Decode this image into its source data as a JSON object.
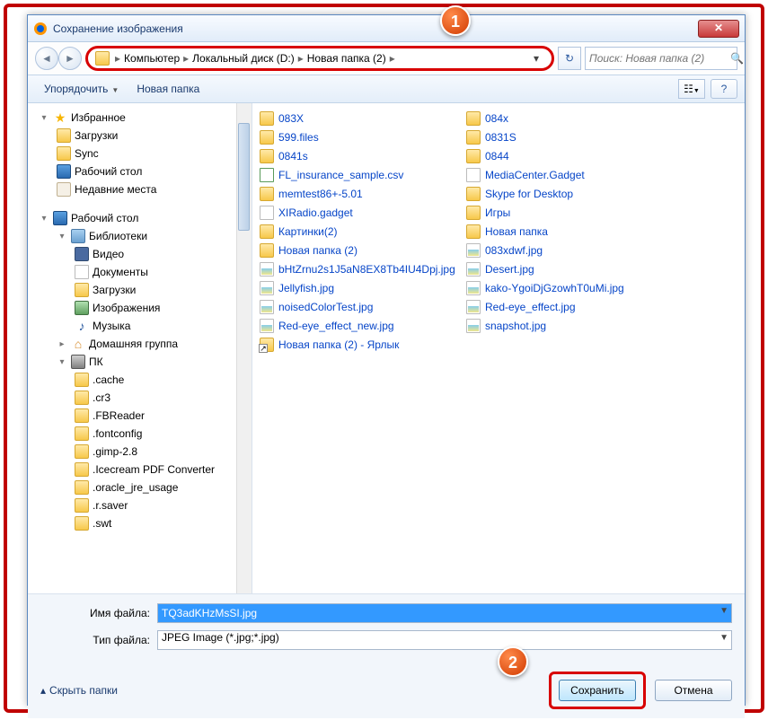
{
  "title": "Сохранение изображения",
  "breadcrumb": [
    "Компьютер",
    "Локальный диск (D:)",
    "Новая папка (2)"
  ],
  "search": {
    "placeholder": "Поиск: Новая папка (2)"
  },
  "toolbar": {
    "organize": "Упорядочить",
    "newfolder": "Новая папка"
  },
  "sidebar": {
    "favorites": {
      "label": "Избранное",
      "items": [
        "Загрузки",
        "Sync",
        "Рабочий стол",
        "Недавние места"
      ]
    },
    "desktop": {
      "label": "Рабочий стол"
    },
    "libraries": {
      "label": "Библиотеки",
      "items": [
        "Видео",
        "Документы",
        "Загрузки",
        "Изображения",
        "Музыка"
      ]
    },
    "homegroup": {
      "label": "Домашняя группа"
    },
    "pc": {
      "label": "ПК",
      "items": [
        ".cache",
        ".cr3",
        ".FBReader",
        ".fontconfig",
        ".gimp-2.8",
        ".Icecream PDF Converter",
        ".oracle_jre_usage",
        ".r.saver",
        ".swt"
      ]
    }
  },
  "files": {
    "col1": [
      {
        "n": "083X",
        "t": "folder"
      },
      {
        "n": "599.files",
        "t": "folder"
      },
      {
        "n": "0841s",
        "t": "folder"
      },
      {
        "n": "FL_insurance_sample.csv",
        "t": "csv"
      },
      {
        "n": "memtest86+-5.01",
        "t": "folder"
      },
      {
        "n": "XIRadio.gadget",
        "t": "gadget"
      },
      {
        "n": "Картинки(2)",
        "t": "folder"
      },
      {
        "n": "Новая папка (2)",
        "t": "folder"
      },
      {
        "n": "bHtZrnu2s1J5aN8EX8Tb4IU4Dpj.jpg",
        "t": "jpeg"
      },
      {
        "n": "Jellyfish.jpg",
        "t": "jpeg"
      },
      {
        "n": "noisedColorTest.jpg",
        "t": "jpeg"
      },
      {
        "n": "Red-eye_effect_new.jpg",
        "t": "jpeg"
      },
      {
        "n": "Новая папка (2) - Ярлык",
        "t": "link"
      }
    ],
    "col2": [
      {
        "n": "084x",
        "t": "folder"
      },
      {
        "n": "0831S",
        "t": "folder"
      },
      {
        "n": "0844",
        "t": "folder"
      },
      {
        "n": "MediaCenter.Gadget",
        "t": "gadget"
      },
      {
        "n": "Skype for Desktop",
        "t": "folder"
      },
      {
        "n": "Игры",
        "t": "folder"
      },
      {
        "n": "Новая папка",
        "t": "folder"
      },
      {
        "n": "083xdwf.jpg",
        "t": "jpeg"
      },
      {
        "n": "Desert.jpg",
        "t": "jpeg"
      },
      {
        "n": "kako-YgoiDjGzowhT0uMi.jpg",
        "t": "jpeg"
      },
      {
        "n": "Red-eye_effect.jpg",
        "t": "jpeg"
      },
      {
        "n": "snapshot.jpg",
        "t": "jpeg"
      }
    ]
  },
  "form": {
    "filename_label": "Имя файла:",
    "filename_value": "TQ3adKHzMsSI.jpg",
    "filetype_label": "Тип файла:",
    "filetype_value": "JPEG Image (*.jpg;*.jpg)"
  },
  "footer": {
    "hide_folders": "Скрыть папки",
    "save": "Сохранить",
    "cancel": "Отмена"
  },
  "markers": {
    "m1": "1",
    "m2": "2"
  }
}
